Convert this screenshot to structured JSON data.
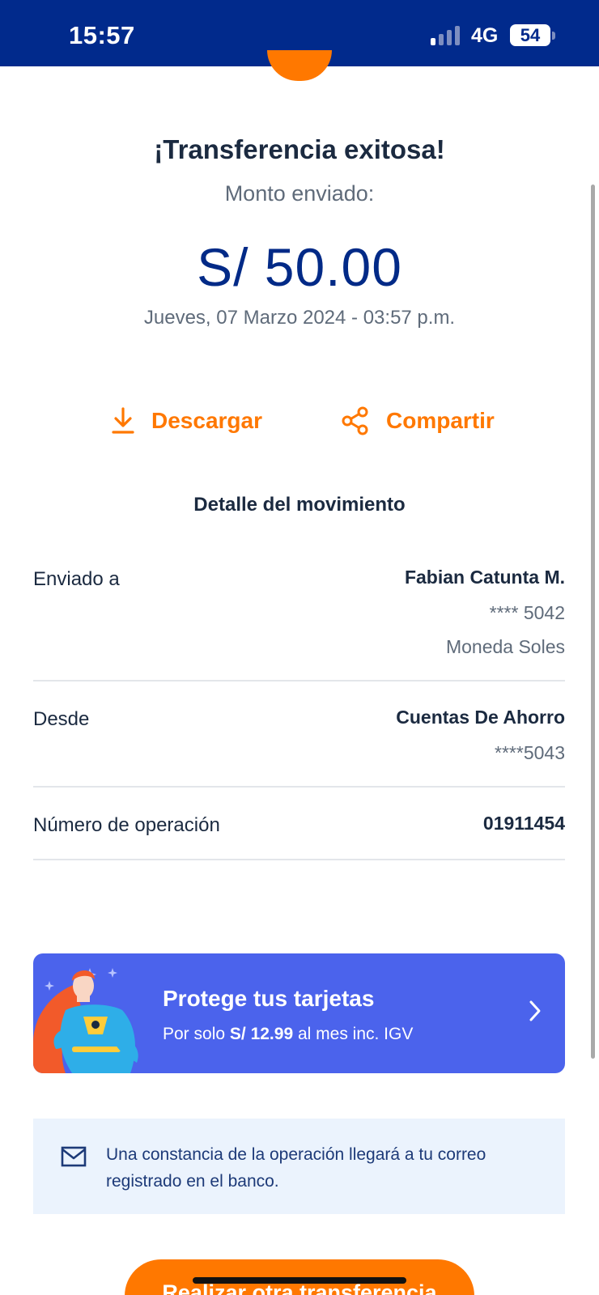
{
  "status_bar": {
    "time": "15:57",
    "network": "4G",
    "battery": "54",
    "signal_bars_active": 1,
    "signal_bars_total": 4
  },
  "colors": {
    "header_blue": "#012a8c",
    "accent_orange": "#ff7800",
    "amount_blue": "#022a87",
    "promo_blue": "#4b63ec",
    "note_bg": "#ebf3fd"
  },
  "receipt": {
    "title": "¡Transferencia exitosa!",
    "amount_label": "Monto enviado:",
    "amount": "S/ 50.00",
    "datetime": "Jueves, 07 Marzo 2024 - 03:57 p.m."
  },
  "actions": {
    "download": {
      "label": "Descargar",
      "icon": "download-icon"
    },
    "share": {
      "label": "Compartir",
      "icon": "share-icon"
    }
  },
  "detail": {
    "title": "Detalle del movimiento",
    "sent_to": {
      "label": "Enviado a",
      "name": "Fabian Catunta M.",
      "account": "**** 5042",
      "currency": "Moneda Soles"
    },
    "from": {
      "label": "Desde",
      "name": "Cuentas De Ahorro",
      "account": "****5043"
    },
    "operation": {
      "label": "Número de operación",
      "value": "01911454"
    }
  },
  "promo": {
    "title": "Protege tus tarjetas",
    "sub_prefix": "Por solo",
    "sub_price": "S/ 12.99",
    "sub_suffix": "al mes inc. IGV",
    "icon": "chevron-right-icon"
  },
  "notice": {
    "icon": "mail-icon",
    "text": "Una constancia de la operación llegará a tu correo registrado en el banco."
  },
  "cta": {
    "label": "Realizar otra transferencia"
  }
}
